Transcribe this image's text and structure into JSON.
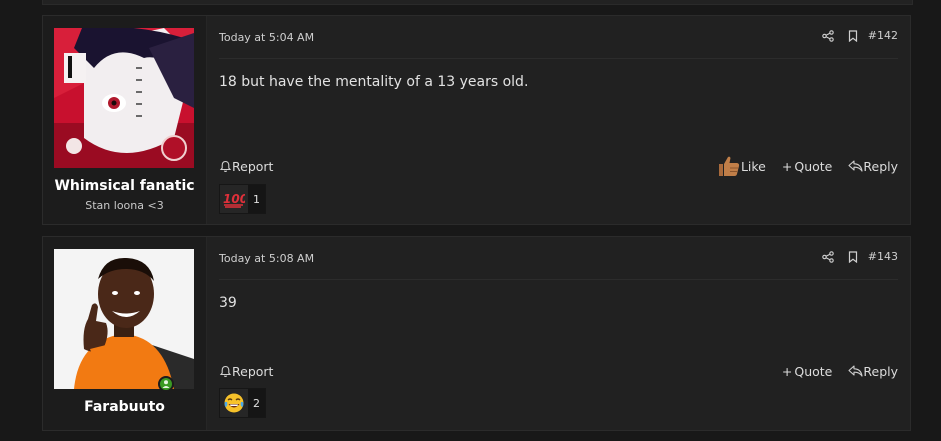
{
  "posts": [
    {
      "username": "Whimsical fanatic",
      "user_title": "Stan loona <3",
      "avatar": "anime-manga-cover-avatar",
      "date": "Today at 5:04 AM",
      "post_number": "#142",
      "body": "18 but have the mentality of a 13 years old.",
      "actions": {
        "report": "Report",
        "like": "Like",
        "quote": "Quote",
        "reply": "Reply"
      },
      "reaction": {
        "emoji": "hundred-points",
        "count": "1"
      }
    },
    {
      "username": "Farabuuto",
      "avatar": "boy-thumbs-up-photo-avatar",
      "online": true,
      "date": "Today at 5:08 AM",
      "post_number": "#143",
      "body": "39",
      "actions": {
        "report": "Report",
        "quote": "Quote",
        "reply": "Reply"
      },
      "reaction": {
        "emoji": "laughing-tears",
        "count": "2"
      }
    }
  ],
  "colors": {
    "background": "#181818",
    "post": "#212121",
    "user_cell": "#1c1c1c",
    "online": "#3b9a23",
    "reaction_100": "#e0303a"
  }
}
